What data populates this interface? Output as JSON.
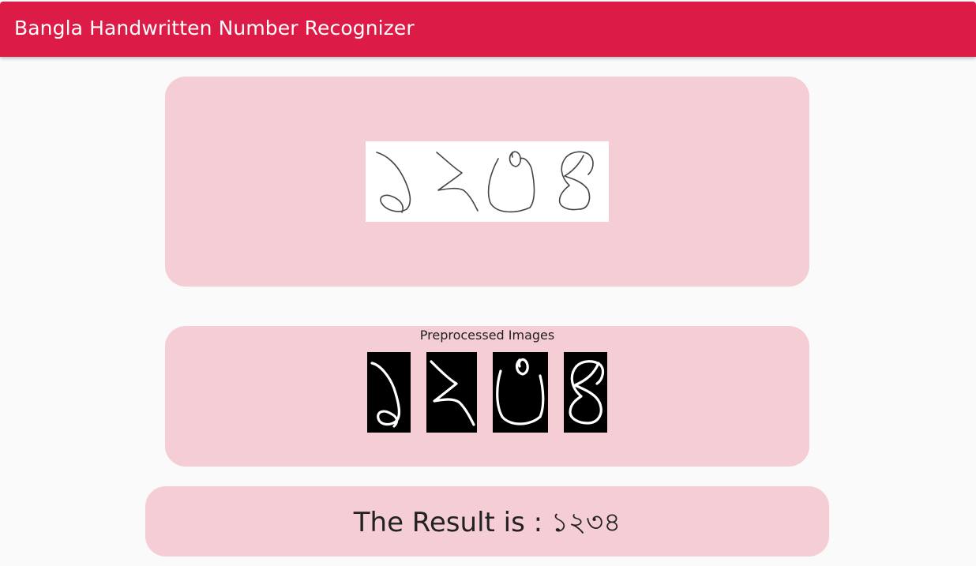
{
  "app": {
    "title": "Bangla Handwritten Number Recognizer"
  },
  "input_card": {
    "drawing_icon": "handwritten-digits-drawing"
  },
  "preprocessed": {
    "label": "Preprocessed Images",
    "images": [
      "digit-1",
      "digit-2",
      "digit-3",
      "digit-4"
    ]
  },
  "result": {
    "prefix": "The Result is : ",
    "value": "১২৩৪"
  },
  "colors": {
    "appbar": "#dc1b46",
    "card": "#f5cdd5",
    "background": "#fafafa"
  }
}
